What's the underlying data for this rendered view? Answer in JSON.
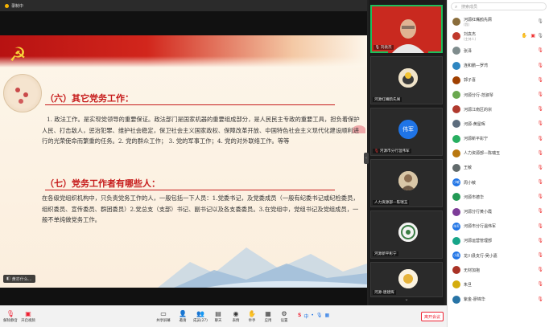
{
  "topbar": {
    "status": "录制中"
  },
  "slide": {
    "heading1": "（六）其它党务工作：",
    "para1": "1. 政法工作。是实现党领导的重要保证。政法部门是国家机器的重要组成部分，是人民民主专政的重要工具，担负着保护人民、打击敌人，惩治犯罪、维护社会稳定，保卫社会主义国家政权、保障改革开放、中国特色社会主义现代化建设顺利进行的光荣使命而繁重的任务。2. 党的群众工作；  3. 党的军事工作；4. 党的对外联络工作。等等",
    "heading2": "（七）党务工作者有哪些人：",
    "para2": "在各级党组织机构中，只负责党务工作的人，一般包括一下人员：1.党委书记，及党委成员（一般有纪委书记或纪检委员，组织委员、宣传委员、群团委员）2.党总支（支部）书记、副书记以及各支委委员。3.在党组中，党组书记及党组成员，一般不单纯做党务工作。",
    "speaking_tag": "黄亦什么..."
  },
  "video": {
    "tiles": [
      {
        "label": "刘袁杰",
        "active": true
      },
      {
        "label": "河源红嘴鸥先屑"
      },
      {
        "label": "河源市分行温伟军",
        "initials": "伟军"
      },
      {
        "label": "人力资源部—陈瑞玉"
      },
      {
        "label": "河源新平彰宁"
      },
      {
        "label": "河源-唐建辉"
      }
    ]
  },
  "participants": {
    "search_placeholder": "搜索成员",
    "items": [
      {
        "name": "河源红嘴鸥先屑",
        "sub": "(我)",
        "color": "#8a6d3b"
      },
      {
        "name": "刘袁杰",
        "sub": "(主持人)",
        "color": "#c0392b"
      },
      {
        "name": "张泽",
        "color": "#7f8c8d"
      },
      {
        "name": "连和鹏—罗湾",
        "color": "#2e86c1"
      },
      {
        "name": "郭子喜",
        "color": "#a04000"
      },
      {
        "name": "河源分行-范淑琴",
        "color": "#6aa84f"
      },
      {
        "name": "河源江南区的宗",
        "color": "#b03a2e"
      },
      {
        "name": "河源-黄屋晖",
        "color": "#5d6d7e"
      },
      {
        "name": "河源新平彰宁",
        "color": "#27ae60"
      },
      {
        "name": "人力资源部—陈瑞玉",
        "color": "#b9770e"
      },
      {
        "name": "王敏",
        "color": "#616a6b"
      },
      {
        "name": "周小敏",
        "initials": "小敏",
        "color": "#1f74e6"
      },
      {
        "name": "河源市德华",
        "color": "#229954"
      },
      {
        "name": "河源分行黄小霞",
        "color": "#7d3c98"
      },
      {
        "name": "河源市分行温伟军",
        "initials": "伟军",
        "color": "#1f74e6"
      },
      {
        "name": "河源运营管理部",
        "color": "#17a589"
      },
      {
        "name": "龙川县支行-吴小嘉",
        "initials": "小嘉",
        "color": "#1f74e6"
      },
      {
        "name": "无材加抱",
        "color": "#a93226"
      },
      {
        "name": "朱旦",
        "color": "#d4ac0d"
      },
      {
        "name": "紫金-廖锦华",
        "color": "#2874a6"
      }
    ]
  },
  "toolbar": {
    "mic": "解除静音",
    "camera": "开启视频",
    "share": "共享屏幕",
    "invite": "邀请",
    "members": "成员(27)",
    "chat": "聊天",
    "emoji": "表情",
    "hand": "举手",
    "record": "应用",
    "settings": "设置",
    "end": "离开会议"
  }
}
